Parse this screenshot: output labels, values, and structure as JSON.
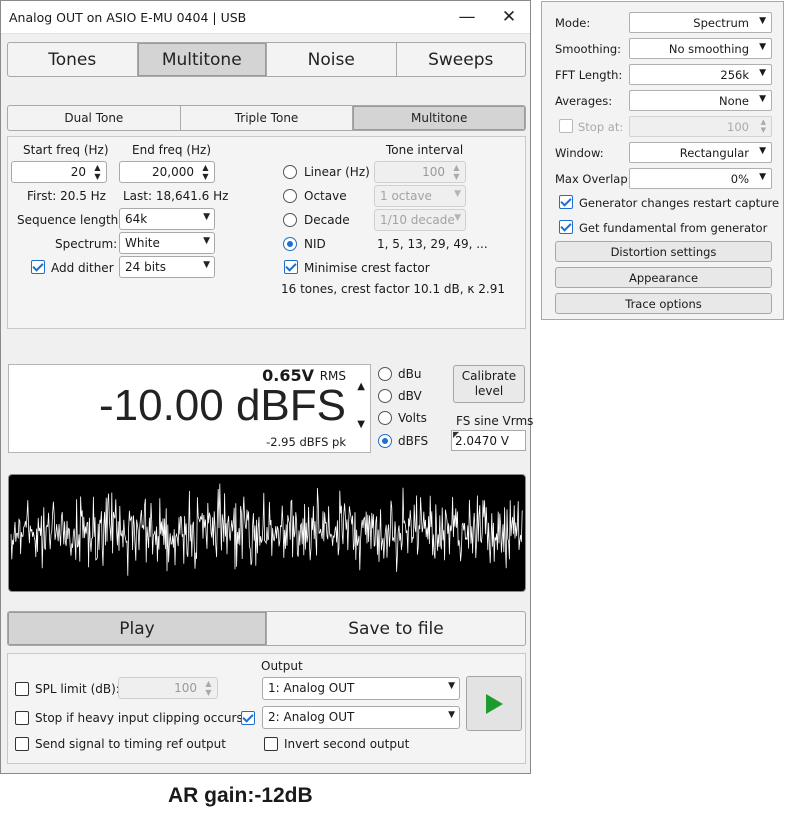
{
  "window": {
    "title": "Analog OUT on ASIO E-MU 0404 | USB",
    "minimize_glyph": "—",
    "close_glyph": "✕"
  },
  "main_tabs": [
    {
      "label": "Tones",
      "selected": false
    },
    {
      "label": "Multitone",
      "selected": true
    },
    {
      "label": "Noise",
      "selected": false
    },
    {
      "label": "Sweeps",
      "selected": false
    }
  ],
  "sub_tabs": [
    {
      "label": "Dual Tone",
      "selected": false
    },
    {
      "label": "Triple Tone",
      "selected": false
    },
    {
      "label": "Multitone",
      "selected": true
    }
  ],
  "multitone": {
    "start_freq": {
      "label": "Start freq (Hz)",
      "value": "20",
      "first": "First: 20.5 Hz"
    },
    "end_freq": {
      "label": "End freq (Hz)",
      "value": "20,000",
      "last": "Last: 18,641.6 Hz"
    },
    "sequence_length": {
      "label": "Sequence length:",
      "value": "64k"
    },
    "spectrum": {
      "label": "Spectrum:",
      "value": "White"
    },
    "add_dither": {
      "label": "Add dither",
      "checked": true,
      "bits": "24 bits"
    },
    "tone_interval": {
      "heading": "Tone interval",
      "options": [
        {
          "label": "Linear (Hz)",
          "value": "100",
          "selected": false
        },
        {
          "label": "Octave",
          "value": "1 octave",
          "selected": false
        },
        {
          "label": "Decade",
          "value": "1/10 decade",
          "selected": false
        },
        {
          "label": "NID",
          "value": "1, 5, 13, 29, 49, ...",
          "selected": true
        }
      ]
    },
    "minimise_crest": {
      "label": "Minimise crest factor",
      "checked": true
    },
    "summary": "16 tones, crest factor 10.1 dB, κ 2.91"
  },
  "level": {
    "rms_value": "0.65V",
    "rms_unit": "RMS",
    "main": "-10.00 dBFS",
    "peak": "-2.95 dBFS pk",
    "units": [
      {
        "label": "dBu",
        "selected": false
      },
      {
        "label": "dBV",
        "selected": false
      },
      {
        "label": "Volts",
        "selected": false
      },
      {
        "label": "dBFS",
        "selected": true
      }
    ],
    "calibrate_label": "Calibrate level",
    "fs_label": "FS sine Vrms",
    "fs_value": "2.0470 V"
  },
  "waveform": {
    "color": "#ffffff",
    "background": "#000000"
  },
  "actions": {
    "play": "Play",
    "save": "Save to file"
  },
  "bottom": {
    "spl_limit": {
      "label": "SPL limit (dB):",
      "checked": false,
      "value": "100"
    },
    "stop_clipping": {
      "label": "Stop if heavy input clipping occurs",
      "checked": false
    },
    "timing_ref": {
      "label": "Send signal to timing ref output",
      "checked": false
    },
    "output_heading": "Output",
    "output1": "1: Analog OUT",
    "output2": {
      "value": "2: Analog OUT",
      "checked": true
    },
    "invert_second": {
      "label": "Invert second output",
      "checked": false
    },
    "play_icon": "play-icon",
    "play_color": "#1e9b2d"
  },
  "side_panel": {
    "rows": [
      {
        "label": "Mode:",
        "value": "Spectrum"
      },
      {
        "label": "Smoothing:",
        "value": "No smoothing"
      },
      {
        "label": "FFT Length:",
        "value": "256k"
      },
      {
        "label": "Averages:",
        "value": "None"
      }
    ],
    "stop_at": {
      "label": "Stop at:",
      "value": "100",
      "checked": false
    },
    "rows2": [
      {
        "label": "Window:",
        "value": "Rectangular"
      },
      {
        "label": "Max Overlap:",
        "value": "0%"
      }
    ],
    "gen_restart": {
      "label": "Generator changes restart capture",
      "checked": true
    },
    "get_fund": {
      "label": "Get fundamental from generator",
      "checked": true
    },
    "buttons": [
      "Distortion settings",
      "Appearance",
      "Trace options"
    ]
  },
  "caption": "AR gain:-12dB"
}
